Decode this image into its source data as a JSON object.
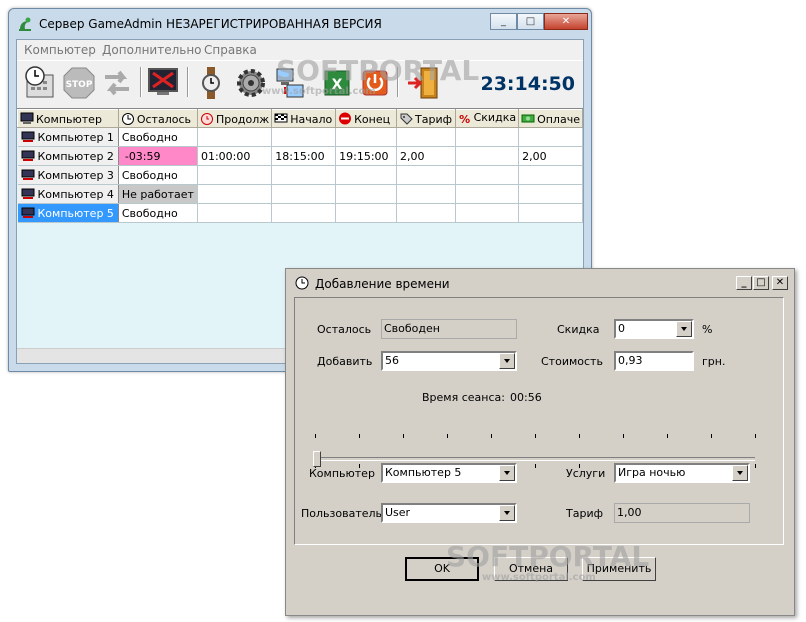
{
  "main_window": {
    "title": "Сервер GameAdmin НЕЗАРЕГИСТРИРОВАННАЯ ВЕРСИЯ",
    "minimize": "0",
    "maximize": "1",
    "close": "r",
    "menu": [
      "Компьютер",
      "Дополнительно",
      "Справка"
    ],
    "clock": "23:14:50",
    "toolbar_icons": [
      "calculator-clock-icon",
      "stop-icon",
      "transfer-arrows-icon",
      "monitor-off-icon",
      "wristwatch-icon",
      "settings-gear-icon",
      "network-computer-icon",
      "excel-export-icon",
      "power-icon",
      "exit-door-icon"
    ]
  },
  "grid": {
    "columns": [
      "Компьютер",
      "Осталось",
      "Продолж",
      "Начало",
      "Конец",
      "Тариф",
      "Скидка",
      "Оплаче"
    ],
    "rows": [
      [
        "Компьютер 1",
        "Свободно",
        "",
        "",
        "",
        "",
        "",
        ""
      ],
      [
        "Компьютер 2",
        "-03:59",
        "01:00:00",
        "18:15:00",
        "19:15:00",
        "2,00",
        "",
        "2,00"
      ],
      [
        "Компьютер 3",
        "Свободно",
        "",
        "",
        "",
        "",
        "",
        ""
      ],
      [
        "Компьютер 4",
        "Не работает",
        "",
        "",
        "",
        "",
        "",
        ""
      ],
      [
        "Компьютер 5",
        "Свободно",
        "",
        "",
        "",
        "",
        "",
        ""
      ]
    ]
  },
  "dialog": {
    "title": "Добавление времени",
    "remaining_label": "Осталось",
    "remaining_value": "Свободен",
    "discount_label": "Скидка",
    "discount_value": "0",
    "percent": "%",
    "add_label": "Добавить",
    "add_value": "56",
    "cost_label": "Стоимость",
    "cost_value": "0,93",
    "currency": "грн.",
    "session_label": "Время сеанса:",
    "session_value": "00:56",
    "computer_label": "Компьютер",
    "computer_value": "Компьютер 5",
    "services_label": "Услуги",
    "services_value": "Игра ночью",
    "user_label": "Пользователь",
    "user_value": "User",
    "tariff_label": "Тариф",
    "tariff_value": "1,00",
    "ok": "OK",
    "cancel": "Отмена",
    "apply": "Применить",
    "slider_position": 0
  },
  "watermark": {
    "brand": "SOFTPORTAL",
    "url": "www.softportal.com"
  }
}
